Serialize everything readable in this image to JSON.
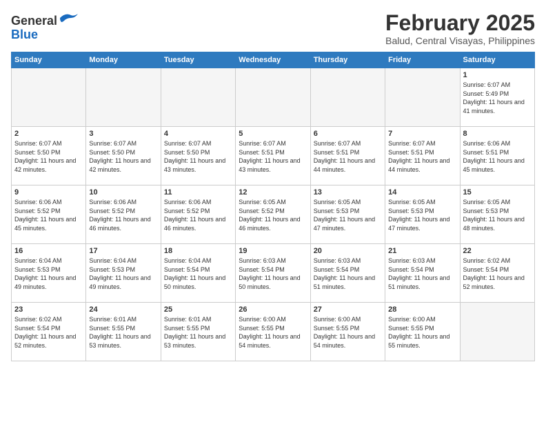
{
  "header": {
    "logo_general": "General",
    "logo_blue": "Blue",
    "title": "February 2025",
    "location": "Balud, Central Visayas, Philippines"
  },
  "weekdays": [
    "Sunday",
    "Monday",
    "Tuesday",
    "Wednesday",
    "Thursday",
    "Friday",
    "Saturday"
  ],
  "weeks": [
    [
      {
        "day": "",
        "sunrise": "",
        "sunset": "",
        "daylight": "",
        "empty": true
      },
      {
        "day": "",
        "sunrise": "",
        "sunset": "",
        "daylight": "",
        "empty": true
      },
      {
        "day": "",
        "sunrise": "",
        "sunset": "",
        "daylight": "",
        "empty": true
      },
      {
        "day": "",
        "sunrise": "",
        "sunset": "",
        "daylight": "",
        "empty": true
      },
      {
        "day": "",
        "sunrise": "",
        "sunset": "",
        "daylight": "",
        "empty": true
      },
      {
        "day": "",
        "sunrise": "",
        "sunset": "",
        "daylight": "",
        "empty": true
      },
      {
        "day": "1",
        "sunrise": "Sunrise: 6:07 AM",
        "sunset": "Sunset: 5:49 PM",
        "daylight": "Daylight: 11 hours and 41 minutes.",
        "empty": false
      }
    ],
    [
      {
        "day": "2",
        "sunrise": "Sunrise: 6:07 AM",
        "sunset": "Sunset: 5:50 PM",
        "daylight": "Daylight: 11 hours and 42 minutes.",
        "empty": false
      },
      {
        "day": "3",
        "sunrise": "Sunrise: 6:07 AM",
        "sunset": "Sunset: 5:50 PM",
        "daylight": "Daylight: 11 hours and 42 minutes.",
        "empty": false
      },
      {
        "day": "4",
        "sunrise": "Sunrise: 6:07 AM",
        "sunset": "Sunset: 5:50 PM",
        "daylight": "Daylight: 11 hours and 43 minutes.",
        "empty": false
      },
      {
        "day": "5",
        "sunrise": "Sunrise: 6:07 AM",
        "sunset": "Sunset: 5:51 PM",
        "daylight": "Daylight: 11 hours and 43 minutes.",
        "empty": false
      },
      {
        "day": "6",
        "sunrise": "Sunrise: 6:07 AM",
        "sunset": "Sunset: 5:51 PM",
        "daylight": "Daylight: 11 hours and 44 minutes.",
        "empty": false
      },
      {
        "day": "7",
        "sunrise": "Sunrise: 6:07 AM",
        "sunset": "Sunset: 5:51 PM",
        "daylight": "Daylight: 11 hours and 44 minutes.",
        "empty": false
      },
      {
        "day": "8",
        "sunrise": "Sunrise: 6:06 AM",
        "sunset": "Sunset: 5:51 PM",
        "daylight": "Daylight: 11 hours and 45 minutes.",
        "empty": false
      }
    ],
    [
      {
        "day": "9",
        "sunrise": "Sunrise: 6:06 AM",
        "sunset": "Sunset: 5:52 PM",
        "daylight": "Daylight: 11 hours and 45 minutes.",
        "empty": false
      },
      {
        "day": "10",
        "sunrise": "Sunrise: 6:06 AM",
        "sunset": "Sunset: 5:52 PM",
        "daylight": "Daylight: 11 hours and 46 minutes.",
        "empty": false
      },
      {
        "day": "11",
        "sunrise": "Sunrise: 6:06 AM",
        "sunset": "Sunset: 5:52 PM",
        "daylight": "Daylight: 11 hours and 46 minutes.",
        "empty": false
      },
      {
        "day": "12",
        "sunrise": "Sunrise: 6:05 AM",
        "sunset": "Sunset: 5:52 PM",
        "daylight": "Daylight: 11 hours and 46 minutes.",
        "empty": false
      },
      {
        "day": "13",
        "sunrise": "Sunrise: 6:05 AM",
        "sunset": "Sunset: 5:53 PM",
        "daylight": "Daylight: 11 hours and 47 minutes.",
        "empty": false
      },
      {
        "day": "14",
        "sunrise": "Sunrise: 6:05 AM",
        "sunset": "Sunset: 5:53 PM",
        "daylight": "Daylight: 11 hours and 47 minutes.",
        "empty": false
      },
      {
        "day": "15",
        "sunrise": "Sunrise: 6:05 AM",
        "sunset": "Sunset: 5:53 PM",
        "daylight": "Daylight: 11 hours and 48 minutes.",
        "empty": false
      }
    ],
    [
      {
        "day": "16",
        "sunrise": "Sunrise: 6:04 AM",
        "sunset": "Sunset: 5:53 PM",
        "daylight": "Daylight: 11 hours and 49 minutes.",
        "empty": false
      },
      {
        "day": "17",
        "sunrise": "Sunrise: 6:04 AM",
        "sunset": "Sunset: 5:53 PM",
        "daylight": "Daylight: 11 hours and 49 minutes.",
        "empty": false
      },
      {
        "day": "18",
        "sunrise": "Sunrise: 6:04 AM",
        "sunset": "Sunset: 5:54 PM",
        "daylight": "Daylight: 11 hours and 50 minutes.",
        "empty": false
      },
      {
        "day": "19",
        "sunrise": "Sunrise: 6:03 AM",
        "sunset": "Sunset: 5:54 PM",
        "daylight": "Daylight: 11 hours and 50 minutes.",
        "empty": false
      },
      {
        "day": "20",
        "sunrise": "Sunrise: 6:03 AM",
        "sunset": "Sunset: 5:54 PM",
        "daylight": "Daylight: 11 hours and 51 minutes.",
        "empty": false
      },
      {
        "day": "21",
        "sunrise": "Sunrise: 6:03 AM",
        "sunset": "Sunset: 5:54 PM",
        "daylight": "Daylight: 11 hours and 51 minutes.",
        "empty": false
      },
      {
        "day": "22",
        "sunrise": "Sunrise: 6:02 AM",
        "sunset": "Sunset: 5:54 PM",
        "daylight": "Daylight: 11 hours and 52 minutes.",
        "empty": false
      }
    ],
    [
      {
        "day": "23",
        "sunrise": "Sunrise: 6:02 AM",
        "sunset": "Sunset: 5:54 PM",
        "daylight": "Daylight: 11 hours and 52 minutes.",
        "empty": false
      },
      {
        "day": "24",
        "sunrise": "Sunrise: 6:01 AM",
        "sunset": "Sunset: 5:55 PM",
        "daylight": "Daylight: 11 hours and 53 minutes.",
        "empty": false
      },
      {
        "day": "25",
        "sunrise": "Sunrise: 6:01 AM",
        "sunset": "Sunset: 5:55 PM",
        "daylight": "Daylight: 11 hours and 53 minutes.",
        "empty": false
      },
      {
        "day": "26",
        "sunrise": "Sunrise: 6:00 AM",
        "sunset": "Sunset: 5:55 PM",
        "daylight": "Daylight: 11 hours and 54 minutes.",
        "empty": false
      },
      {
        "day": "27",
        "sunrise": "Sunrise: 6:00 AM",
        "sunset": "Sunset: 5:55 PM",
        "daylight": "Daylight: 11 hours and 54 minutes.",
        "empty": false
      },
      {
        "day": "28",
        "sunrise": "Sunrise: 6:00 AM",
        "sunset": "Sunset: 5:55 PM",
        "daylight": "Daylight: 11 hours and 55 minutes.",
        "empty": false
      },
      {
        "day": "",
        "sunrise": "",
        "sunset": "",
        "daylight": "",
        "empty": true
      }
    ]
  ]
}
